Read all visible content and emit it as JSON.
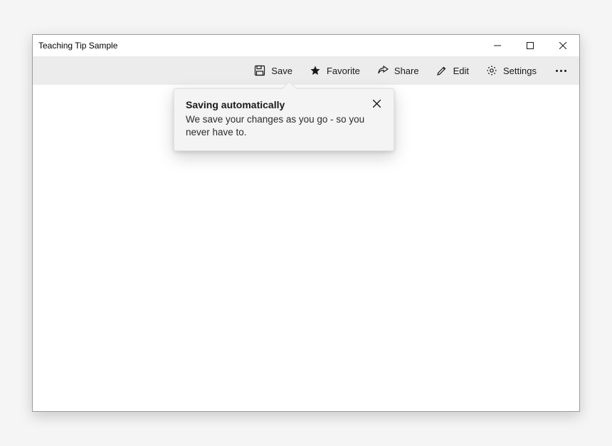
{
  "window": {
    "title": "Teaching Tip Sample"
  },
  "commandbar": {
    "save_label": "Save",
    "favorite_label": "Favorite",
    "share_label": "Share",
    "edit_label": "Edit",
    "settings_label": "Settings",
    "icons": {
      "save": "save-icon",
      "favorite": "star-icon",
      "share": "share-icon",
      "edit": "edit-icon",
      "settings": "gear-icon",
      "more": "more-icon"
    }
  },
  "teaching_tip": {
    "title": "Saving automatically",
    "body": "We save your changes as you go - so you never have to."
  }
}
